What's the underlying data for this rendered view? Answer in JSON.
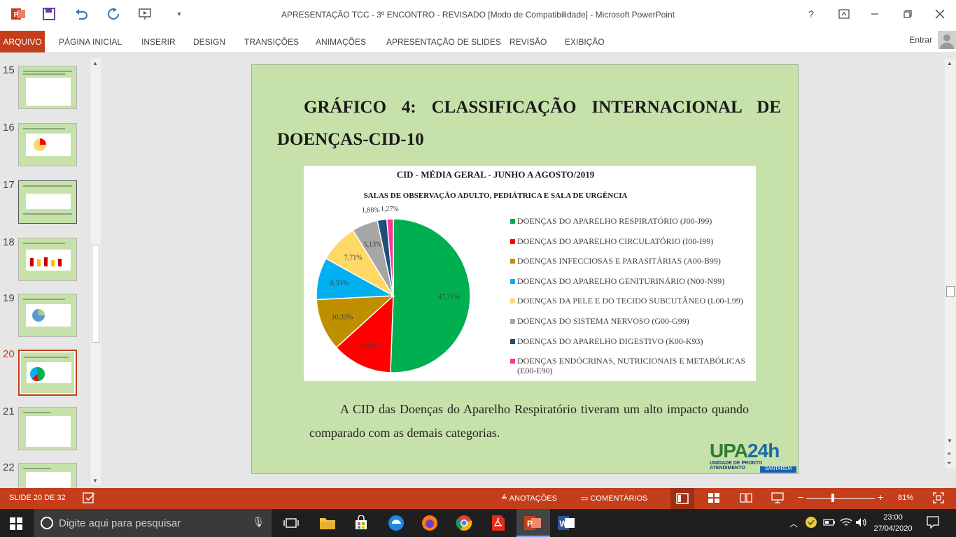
{
  "window": {
    "title": "APRESENTAÇÃO TCC - 3º ENCONTRO - REVISADO [Modo de Compatibilidade] - Microsoft PowerPoint",
    "help": "?"
  },
  "ribbon": {
    "tabs": [
      "ARQUIVO",
      "PÁGINA INICIAL",
      "INSERIR",
      "DESIGN",
      "TRANSIÇÕES",
      "ANIMAÇÕES",
      "APRESENTAÇÃO DE SLIDES",
      "REVISÃO",
      "EXIBIÇÃO"
    ],
    "sign_in": "Entrar"
  },
  "thumbnails": [
    {
      "num": "15"
    },
    {
      "num": "16"
    },
    {
      "num": "17"
    },
    {
      "num": "18"
    },
    {
      "num": "19"
    },
    {
      "num": "20",
      "selected": true
    },
    {
      "num": "21"
    },
    {
      "num": "22"
    }
  ],
  "slide": {
    "title": "GRÁFICO 4: CLASSIFICAÇÃO   INTERNACIONAL DE DOENÇAS-CID-10",
    "body": "A CID das Doenças do Aparelho Respiratório tiveram um alto impacto quando comparado com as demais categorias.",
    "logo": {
      "main": "UPA",
      "num": "24h",
      "sub": "UNIDADE DE PRONTO ATENDIMENTO",
      "city": "SANTARÉM"
    }
  },
  "chart_data": {
    "type": "pie",
    "title": "CID - MÉDIA  GERAL - JUNHO A AGOSTO/2019",
    "subtitle": "SALAS DE OBSERVAÇÃO ADULTO, PEDIÁTRICA E SALA DE URGÊNCIA",
    "legend_position": "right",
    "slices": [
      {
        "name": "DOENÇAS DO APARELHO RESPIRATÓRIO (J00-J99)",
        "value": 47.71,
        "label": "47,71%",
        "color": "#00b050"
      },
      {
        "name": "DOENÇAS DO APARELHO CIRCULATÓRIO (I00-I99)",
        "value": 11.94,
        "label": "11,94%",
        "color": "#ff0000"
      },
      {
        "name": "DOENÇAS INFECCIOSAS E PARASITÁRIAS (A00-B99)",
        "value": 10.33,
        "label": "10,33%",
        "color": "#bf8f00"
      },
      {
        "name": "DOENÇAS DO APARELHO GENITURINÁRIO (N00-N99)",
        "value": 8.33,
        "label": "8,33%",
        "color": "#00b0f0"
      },
      {
        "name": "DOENÇAS DA PELE E DO TECIDO SUBCUTÂNEO (L00-L99)",
        "value": 7.71,
        "label": "7,71%",
        "color": "#ffd966"
      },
      {
        "name": "DOENÇAS DO SISTEMA NERVOSO (G00-G99)",
        "value": 5.13,
        "label": "5,13%",
        "color": "#a6a6a6"
      },
      {
        "name": "DOENÇAS DO APARELHO DIGESTIVO (K00-K93)",
        "value": 1.88,
        "label": "1,88%",
        "color": "#1f4e79"
      },
      {
        "name": "DOENÇAS ENDÓCRINAS, NUTRICIONAIS E METABÓLICAS (E00-E90)",
        "value": 1.27,
        "label": "1,27%",
        "color": "#ff3399"
      }
    ]
  },
  "status": {
    "slide_counter": "SLIDE 20 DE 32",
    "notes": "ANOTAÇÕES",
    "comments": "COMENTÁRIOS",
    "zoom_minus": "−",
    "zoom_plus": "+",
    "zoom": "81%"
  },
  "taskbar": {
    "search_placeholder": "Digite aqui para pesquisar",
    "time": "23:00",
    "date": "27/04/2020"
  }
}
